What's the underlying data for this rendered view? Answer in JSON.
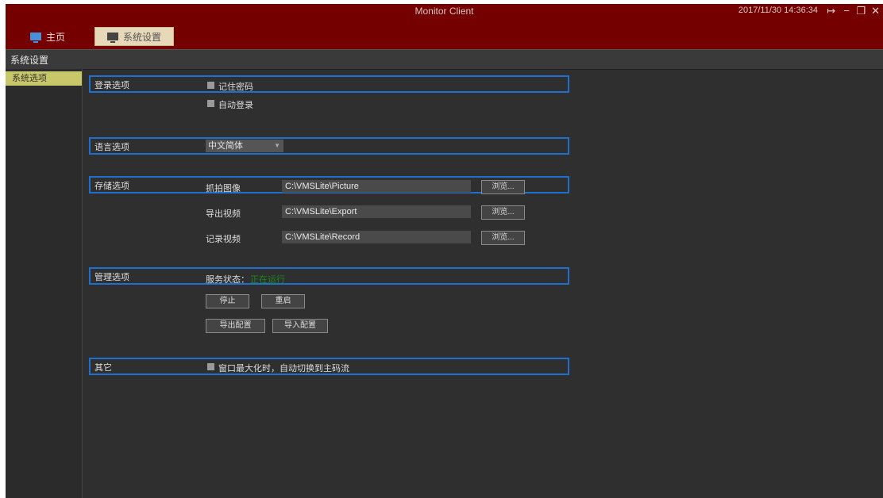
{
  "window": {
    "title": "Monitor Client",
    "datetime": "2017/11/30 14:36:34",
    "logout_glyph": "↦",
    "minimize_glyph": "−",
    "restore_glyph": "❐",
    "close_glyph": "✕"
  },
  "nav": {
    "home_label": "主页",
    "settings_label": "系统设置"
  },
  "breadcrumb": "系统设置",
  "sidebar": {
    "items": [
      {
        "label": "系统选项"
      }
    ]
  },
  "sections": {
    "login": {
      "label": "登录选项",
      "remember_password": "记住密码",
      "auto_login": "自动登录"
    },
    "language": {
      "label": "语言选项",
      "selected": "中文简体",
      "arrow": "▼"
    },
    "storage": {
      "label": "存储选项",
      "rows": [
        {
          "label": "抓拍图像",
          "path": "C:\\VMSLite\\Picture",
          "browse": "浏览..."
        },
        {
          "label": "导出视频",
          "path": "C:\\VMSLite\\Export",
          "browse": "浏览..."
        },
        {
          "label": "记录视频",
          "path": "C:\\VMSLite\\Record",
          "browse": "浏览..."
        }
      ]
    },
    "management": {
      "label": "管理选项",
      "service_status_label": "服务状态：",
      "service_status_value": "正在运行",
      "stop": "停止",
      "restart": "重启",
      "export_config": "导出配置",
      "import_config": "导入配置"
    },
    "other": {
      "label": "其它",
      "auto_switch": "窗口最大化时，自动切换到主码流"
    }
  },
  "colors": {
    "titlebar": "#740000",
    "accent_border": "#1e6fd0",
    "status_running": "#1a8a1a",
    "selected_tab": "#e6d8b8",
    "sidebar_selected": "#c8c86a"
  }
}
